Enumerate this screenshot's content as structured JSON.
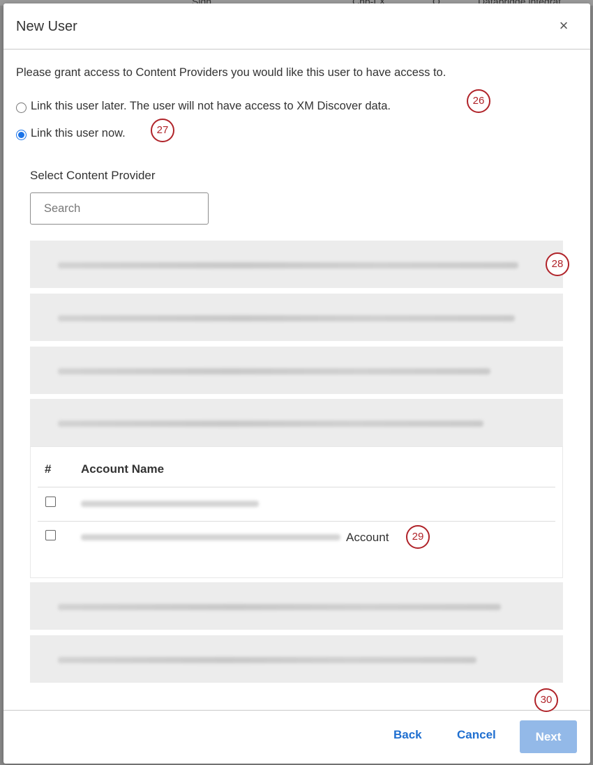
{
  "background": {
    "fragments": [
      "Sign",
      "Cnb-LX",
      "Q",
      "Databridge integrat"
    ]
  },
  "modal": {
    "title": "New User",
    "close_glyph": "×",
    "intro_text": "Please grant access to Content Providers you would like this user to have access to.",
    "options": [
      {
        "label": "Link this user later. The user will not have access to XM Discover data.",
        "checked": false
      },
      {
        "label": "Link this user now.",
        "checked": true
      }
    ],
    "select_label": "Select Content Provider",
    "search": {
      "placeholder": "Search",
      "value": ""
    },
    "accounts_table": {
      "headers": {
        "index": "#",
        "name": "Account Name"
      },
      "rows": [
        {
          "name_suffix": ""
        },
        {
          "name_suffix": "Account"
        }
      ]
    },
    "footer": {
      "back_label": "Back",
      "cancel_label": "Cancel",
      "next_label": "Next"
    }
  },
  "callouts": [
    "26",
    "27",
    "28",
    "29",
    "30"
  ],
  "colors": {
    "accent": "#1f6fd0",
    "radio_checked": "#1a73e8",
    "next_disabled": "#93b9e8",
    "callout": "#b02329",
    "provider_bg": "#ececec"
  }
}
